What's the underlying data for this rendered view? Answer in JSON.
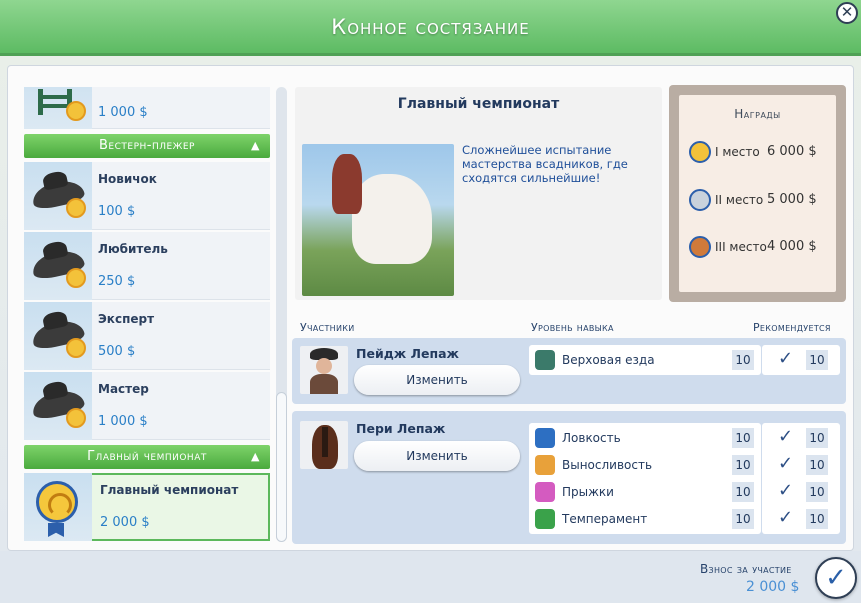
{
  "window": {
    "title": "Конное состязание",
    "close_glyph": "✕"
  },
  "list": {
    "top_item": {
      "price": "1 000 $"
    },
    "categories": [
      {
        "name": "Вестерн-плежер",
        "items": [
          {
            "name": "Новичок",
            "price": "100 $"
          },
          {
            "name": "Любитель",
            "price": "250 $"
          },
          {
            "name": "Эксперт",
            "price": "500 $"
          },
          {
            "name": "Мастер",
            "price": "1 000 $"
          }
        ]
      },
      {
        "name": "Главный чемпионат",
        "items": [
          {
            "name": "Главный чемпионат",
            "price": "2 000 $",
            "selected": true
          }
        ]
      }
    ],
    "collapse_glyph": "▲"
  },
  "detail": {
    "title": "Главный чемпионат",
    "description": "Сложнейшее испытание мастерства всадников, где сходятся сильнейшие!"
  },
  "rewards": {
    "title": "Награды",
    "rows": [
      {
        "place": "I место",
        "amount": "6 000 $",
        "color": "#f3c23a"
      },
      {
        "place": "II место",
        "amount": "5 000 $",
        "color": "#c9d2dc"
      },
      {
        "place": "III место",
        "amount": "4 000 $",
        "color": "#d07a3a"
      }
    ]
  },
  "columns": {
    "participants": "Участники",
    "skill_level": "Уровень навыка",
    "recommended": "Рекомендуется"
  },
  "participants": [
    {
      "name": "Пейдж Лепаж",
      "change_label": "Изменить",
      "skills": [
        {
          "name": "Верховая езда",
          "level": "10",
          "recommended": "10",
          "icon": "riding-icon",
          "color": "#3b7a6a"
        }
      ]
    },
    {
      "name": "Пери Лепаж",
      "change_label": "Изменить",
      "skills": [
        {
          "name": "Ловкость",
          "level": "10",
          "recommended": "10",
          "icon": "agility-icon",
          "color": "#2d6fc2"
        },
        {
          "name": "Выносливость",
          "level": "10",
          "recommended": "10",
          "icon": "endurance-icon",
          "color": "#e8a13a"
        },
        {
          "name": "Прыжки",
          "level": "10",
          "recommended": "10",
          "icon": "jumping-icon",
          "color": "#d45bc0"
        },
        {
          "name": "Темперамент",
          "level": "10",
          "recommended": "10",
          "icon": "temperament-icon",
          "color": "#3aa24a"
        }
      ]
    }
  ],
  "footer": {
    "fee_label": "Взнос за участие",
    "fee_amount": "2 000 $",
    "confirm_glyph": "✓"
  },
  "check_glyph": "✓"
}
